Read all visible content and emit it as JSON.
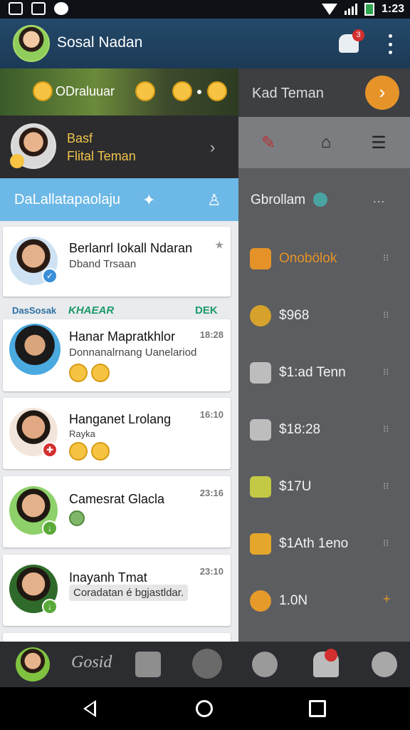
{
  "status_bar": {
    "time": "1:23",
    "icons": [
      "camera-icon",
      "gallery-icon",
      "chat-bubble-icon",
      "wifi-icon",
      "signal-icon",
      "battery-icon"
    ]
  },
  "app_bar": {
    "title": "Sosal Nadan",
    "notification_count": "3",
    "icons": [
      "notification-icon",
      "overflow-menu-icon"
    ]
  },
  "banner": {
    "text": "ODraluuar"
  },
  "profile": {
    "line1": "Basf",
    "line2": "Flital Teman"
  },
  "tab": {
    "label": "DaLallatapaolaju"
  },
  "feed": {
    "section_left": "DasSosak",
    "section_middle": "KHAEAR",
    "section_right": "DEK",
    "cards": [
      {
        "name": "Berlanrl Iokall Ndaran",
        "sub": "Dband Trsaan",
        "time": ""
      },
      {
        "name": "Hanar Mapratkhlor",
        "sub": "Donnanalrnang Uanelariod",
        "time": "18:28"
      },
      {
        "name": "Hanganet Lrolang",
        "sub": "Rayka",
        "time": "16:10"
      },
      {
        "name": "Camesrat Glacla",
        "sub": "",
        "time": "23:16"
      },
      {
        "name": "Inayanh Tmat",
        "sub": "Coradatan é bgjastldar.",
        "time": "23:10"
      }
    ]
  },
  "drawer": {
    "title": "Kad Teman",
    "header": "Gbrollam",
    "header_more": "…",
    "items": [
      {
        "label": "Onobölok",
        "color": "#e59328"
      },
      {
        "label": "$968",
        "color": "#d6a22b"
      },
      {
        "label": "$1:ad Tenn",
        "color": "#bdbdbd"
      },
      {
        "label": "$18:28",
        "color": "#bdbdbd"
      },
      {
        "label": "$17U",
        "color": "#c3c944"
      },
      {
        "label": "$1Ath 1eno",
        "color": "#e5a72b"
      },
      {
        "label": "1.0N",
        "color": "#e59a2a"
      }
    ]
  },
  "bottom_bar": {
    "logo": "Gosid",
    "icons": [
      "avatar",
      "app-logo",
      "chat-icon",
      "circle-icon",
      "user-icon",
      "bell-icon",
      "profile-icon"
    ]
  },
  "nav_bar": {
    "icons": [
      "back-icon",
      "home-icon",
      "recents-icon"
    ]
  },
  "colors": {
    "appbar": "#1f4262",
    "tab_accent": "#6cb8e6",
    "profile_text": "#f0c44c",
    "next_button": "#e6942a",
    "drawer_bg": "#5b5d60"
  }
}
